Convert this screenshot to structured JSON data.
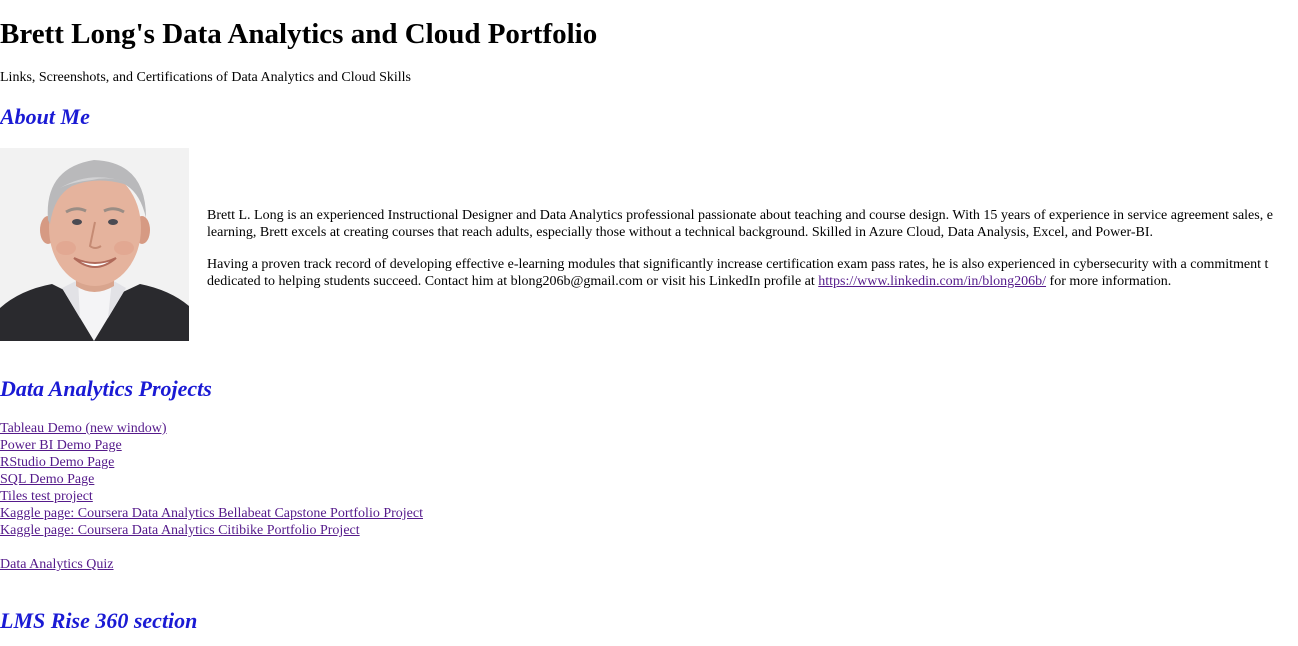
{
  "header": {
    "title": "Brett Long's Data Analytics and Cloud Portfolio",
    "subtitle": "Links, Screenshots, and Certifications of Data Analytics and Cloud Skills"
  },
  "about": {
    "heading": "About Me",
    "photo_icon": "portrait-photo",
    "para1_line1": "Brett L. Long is an experienced Instructional Designer and Data Analytics professional passionate about teaching and course design. With 15 years of experience in service agreement sales, e",
    "para1_line2": "learning, Brett excels at creating courses that reach adults, especially those without a technical background. Skilled in Azure Cloud, Data Analysis, Excel, and Power-BI.",
    "para2_line1": "Having a proven track record of developing effective e-learning modules that significantly increase certification exam pass rates, he is also experienced in cybersecurity with a commitment t",
    "para2_line2_prefix": "dedicated to helping students succeed. Contact him at blong206b@gmail.com or visit his LinkedIn profile at ",
    "linkedin_link": "https://www.linkedin.com/in/blong206b/",
    "para2_line2_suffix": " for more information."
  },
  "projects": {
    "heading": "Data Analytics Projects",
    "links": [
      "Tableau Demo (new window)",
      "Power BI Demo Page",
      "RStudio Demo Page",
      "SQL Demo Page",
      "Tiles test project",
      "Kaggle page: Coursera Data Analytics Bellabeat Capstone Portfolio Project",
      "Kaggle page: Coursera Data Analytics Citibike Portfolio Project"
    ],
    "quiz_link": "Data Analytics Quiz"
  },
  "lms": {
    "heading": "LMS Rise 360 section"
  },
  "colors": {
    "section_heading": "#1a1ad4",
    "visited_link": "#551a8b"
  }
}
